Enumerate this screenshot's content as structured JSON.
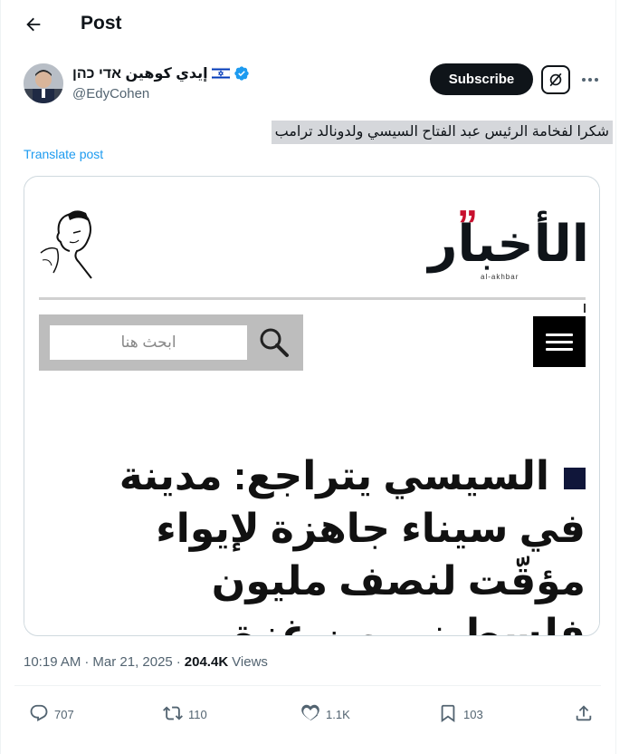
{
  "header": {
    "title": "Post"
  },
  "author": {
    "name": "إيدي كوهين אדי כהן",
    "flag": "🇮🇱",
    "handle": "@EdyCohen",
    "verified_color": "#1d9bf0"
  },
  "actions_top": {
    "subscribe_label": "Subscribe"
  },
  "tweet": {
    "text": "شكرا لفخامة الرئيس عبد الفتاح السيسي ولدونالد ترامب",
    "translate_label": "Translate post"
  },
  "media": {
    "brand": "الأخبار",
    "brand_sub": "al-akhbar",
    "search_placeholder": "ابحث هنا",
    "headline": "السيسي يتراجع: مدينة في سيناء جاهزة لإيواء مؤقّت لنصف مليون فلسطيني من غزة"
  },
  "meta": {
    "time": "10:19 AM",
    "dot": "·",
    "date": "Mar 21, 2025",
    "dot2": "·",
    "views_count": "204.4K",
    "views_label": "Views"
  },
  "stats": {
    "replies": "707",
    "reposts": "110",
    "likes": "1.1K",
    "bookmarks": "103"
  },
  "colors": {
    "accent": "#1d9bf0",
    "text": "#0f1419",
    "muted": "#536471",
    "brand_red": "#c8102e"
  }
}
